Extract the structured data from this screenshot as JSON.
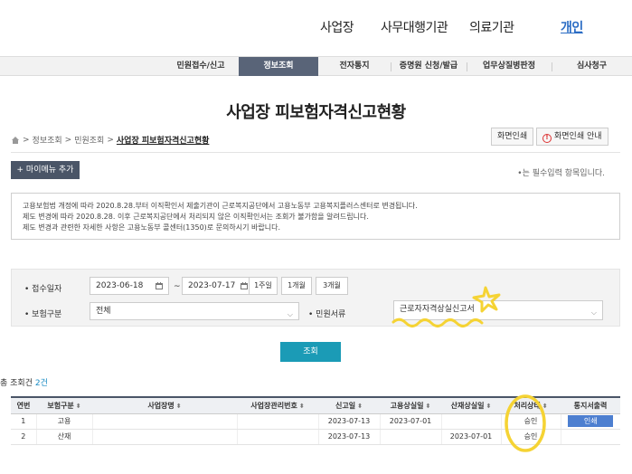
{
  "top_nav": {
    "items": [
      {
        "label": "사업장",
        "active": false
      },
      {
        "label": "사무대행기관",
        "active": false
      },
      {
        "label": "의료기관",
        "active": false
      },
      {
        "label": "개인",
        "active": true
      }
    ]
  },
  "menu_bar": {
    "items": [
      {
        "label": "민원접수/신고",
        "active": false
      },
      {
        "label": "정보조회",
        "active": true
      },
      {
        "label": "전자통지",
        "active": false
      },
      {
        "label": "증명원 신청/발급",
        "active": false
      },
      {
        "label": "업무상질병판정",
        "active": false
      },
      {
        "label": "심사청구",
        "active": false
      }
    ]
  },
  "page": {
    "title": "사업장 피보험자격신고현황",
    "breadcrumb": [
      "정보조회",
      "민원조회",
      "사업장 피보험자격신고현황"
    ],
    "print_label": "화면인쇄",
    "print_guide_label": "화면인쇄 안내",
    "mymenu_label": "+ 마이메뉴 추가",
    "required_note": "•는 필수입력 항목입니다."
  },
  "notice": {
    "lines": [
      "고용보험법 개정에 따라 2020.8.28.부터 이직확인서 제출기관이 근로복지공단에서 고용노동부 고용복지플러스센터로 변경됩니다.",
      "제도 변경에 따라 2020.8.28. 이후 근로복지공단에서 처리되지 않은 이직확인서는 조회가 불가함을 알려드립니다.",
      "제도 변경과 관련한 자세한 사항은 고용노동부 콜센터(1350)로 문의하시기 바랍니다."
    ]
  },
  "search": {
    "date_label": "• 접수일자",
    "date_from": "2023-06-18",
    "date_to": "2023-07-17",
    "tilde": "~",
    "periods": [
      "1주일",
      "1개월",
      "3개월"
    ],
    "insurance_label": "• 보험구분",
    "insurance_value": "전체",
    "doc_label": "• 민원서류",
    "doc_value": "근로자자격상실신고서",
    "search_button": "조회"
  },
  "results": {
    "total_label": "총 조회건",
    "total_count": "2건",
    "headers": [
      "연번",
      "보험구분",
      "사업장명",
      "사업장관리번호",
      "신고일",
      "고용상실일",
      "산재상실일",
      "처리상태",
      "통지서출력"
    ],
    "rows": [
      {
        "no": "1",
        "type": "고용",
        "name": "",
        "mgmt": "",
        "report": "2023-07-13",
        "emp_loss": "2023-07-01",
        "ind_loss": "",
        "status": "승인",
        "print": "인쇄"
      },
      {
        "no": "2",
        "type": "산재",
        "name": "",
        "mgmt": "",
        "report": "2023-07-13",
        "emp_loss": "",
        "ind_loss": "2023-07-01",
        "status": "승인",
        "print": ""
      }
    ]
  },
  "colors": {
    "header_dark": "#596478",
    "accent_blue": "#2a6cc4",
    "search_button": "#1b9bb6",
    "highlighter": "#f5d334"
  }
}
